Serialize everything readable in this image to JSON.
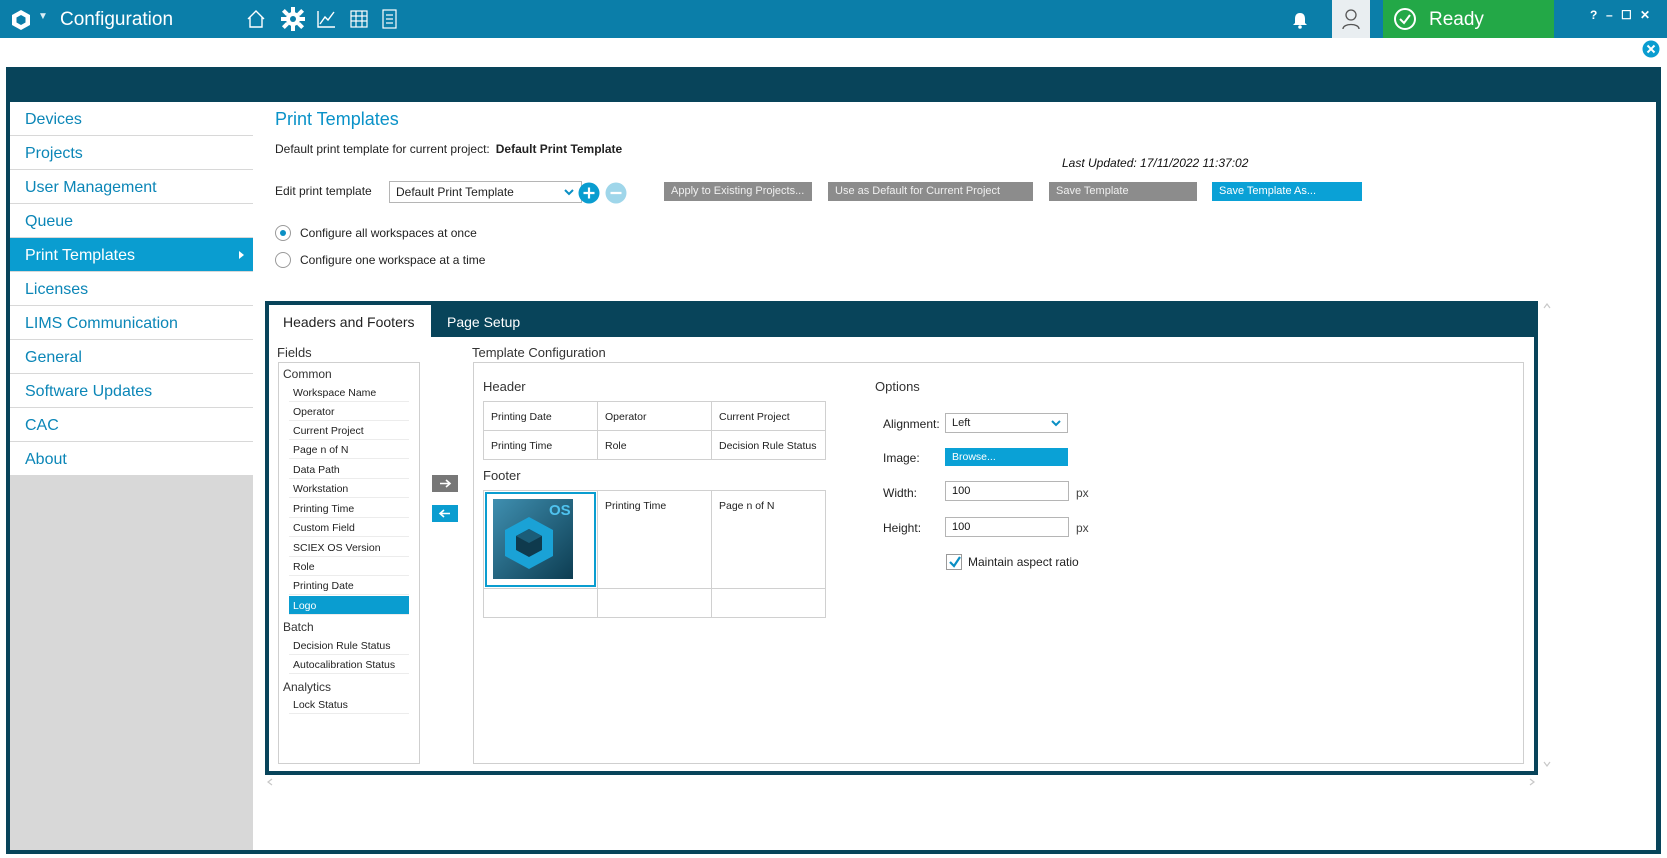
{
  "app": {
    "title": "Configuration",
    "status": "Ready",
    "window_controls": [
      "?",
      "–",
      "☐",
      "✕"
    ],
    "toolbar_icons": [
      "home-icon",
      "gear-icon",
      "chart-icon",
      "grid-icon",
      "notebook-icon"
    ],
    "colors": {
      "title_bar": "#0b7ea9",
      "ready": "#23a847",
      "accent": "#0a9dd0",
      "frame": "#08445a"
    }
  },
  "sidebar": {
    "items": [
      {
        "label": "Devices"
      },
      {
        "label": "Projects"
      },
      {
        "label": "User Management"
      },
      {
        "label": "Queue"
      },
      {
        "label": "Print Templates"
      },
      {
        "label": "Licenses"
      },
      {
        "label": "LIMS Communication"
      },
      {
        "label": "General"
      },
      {
        "label": "Software Updates"
      },
      {
        "label": "CAC"
      },
      {
        "label": "About"
      }
    ],
    "active": "Print Templates"
  },
  "main": {
    "title": "Print Templates",
    "default_label": "Default print template for current project:",
    "default_value": "Default Print Template",
    "last_updated": "Last Updated: 17/11/2022 11:37:02",
    "edit_label": "Edit print template",
    "edit_value": "Default Print Template",
    "buttons": {
      "apply": "Apply to Existing Projects...",
      "use_default": "Use as Default for Current Project",
      "save": "Save Template",
      "save_as": "Save Template As..."
    },
    "radio": {
      "all": "Configure all workspaces at once",
      "one": "Configure one workspace at a time",
      "selected": "all"
    }
  },
  "tabs": {
    "headers": "Headers and Footers",
    "page_setup": "Page Setup",
    "active": "Headers and Footers"
  },
  "fields": {
    "label": "Fields",
    "groups": {
      "common": "Common",
      "batch": "Batch",
      "analytics": "Analytics"
    },
    "common": [
      "Workspace Name",
      "Operator",
      "Current Project",
      "Page n of N",
      "Data Path",
      "Workstation",
      "Printing Time",
      "Custom Field",
      "SCIEX OS Version",
      "Role",
      "Printing Date",
      "Logo"
    ],
    "batch": [
      "Decision Rule Status",
      "Autocalibration Status"
    ],
    "analytics": [
      "Lock Status"
    ],
    "selected": "Logo"
  },
  "template": {
    "label": "Template Configuration",
    "header_label": "Header",
    "footer_label": "Footer",
    "header_cells": [
      "Printing Date",
      "Operator",
      "Current Project",
      "Printing Time",
      "Role",
      "Decision Rule Status"
    ],
    "footer_cells": [
      "",
      "Printing Time",
      "Page n of N",
      "",
      "",
      ""
    ],
    "logo_text": "OS"
  },
  "options": {
    "title": "Options",
    "alignment_label": "Alignment:",
    "alignment_value": "Left",
    "image_label": "Image:",
    "browse": "Browse...",
    "width_label": "Width:",
    "width_value": "100",
    "height_label": "Height:",
    "height_value": "100",
    "unit": "px",
    "maintain_label": "Maintain aspect ratio",
    "maintain_checked": true
  }
}
